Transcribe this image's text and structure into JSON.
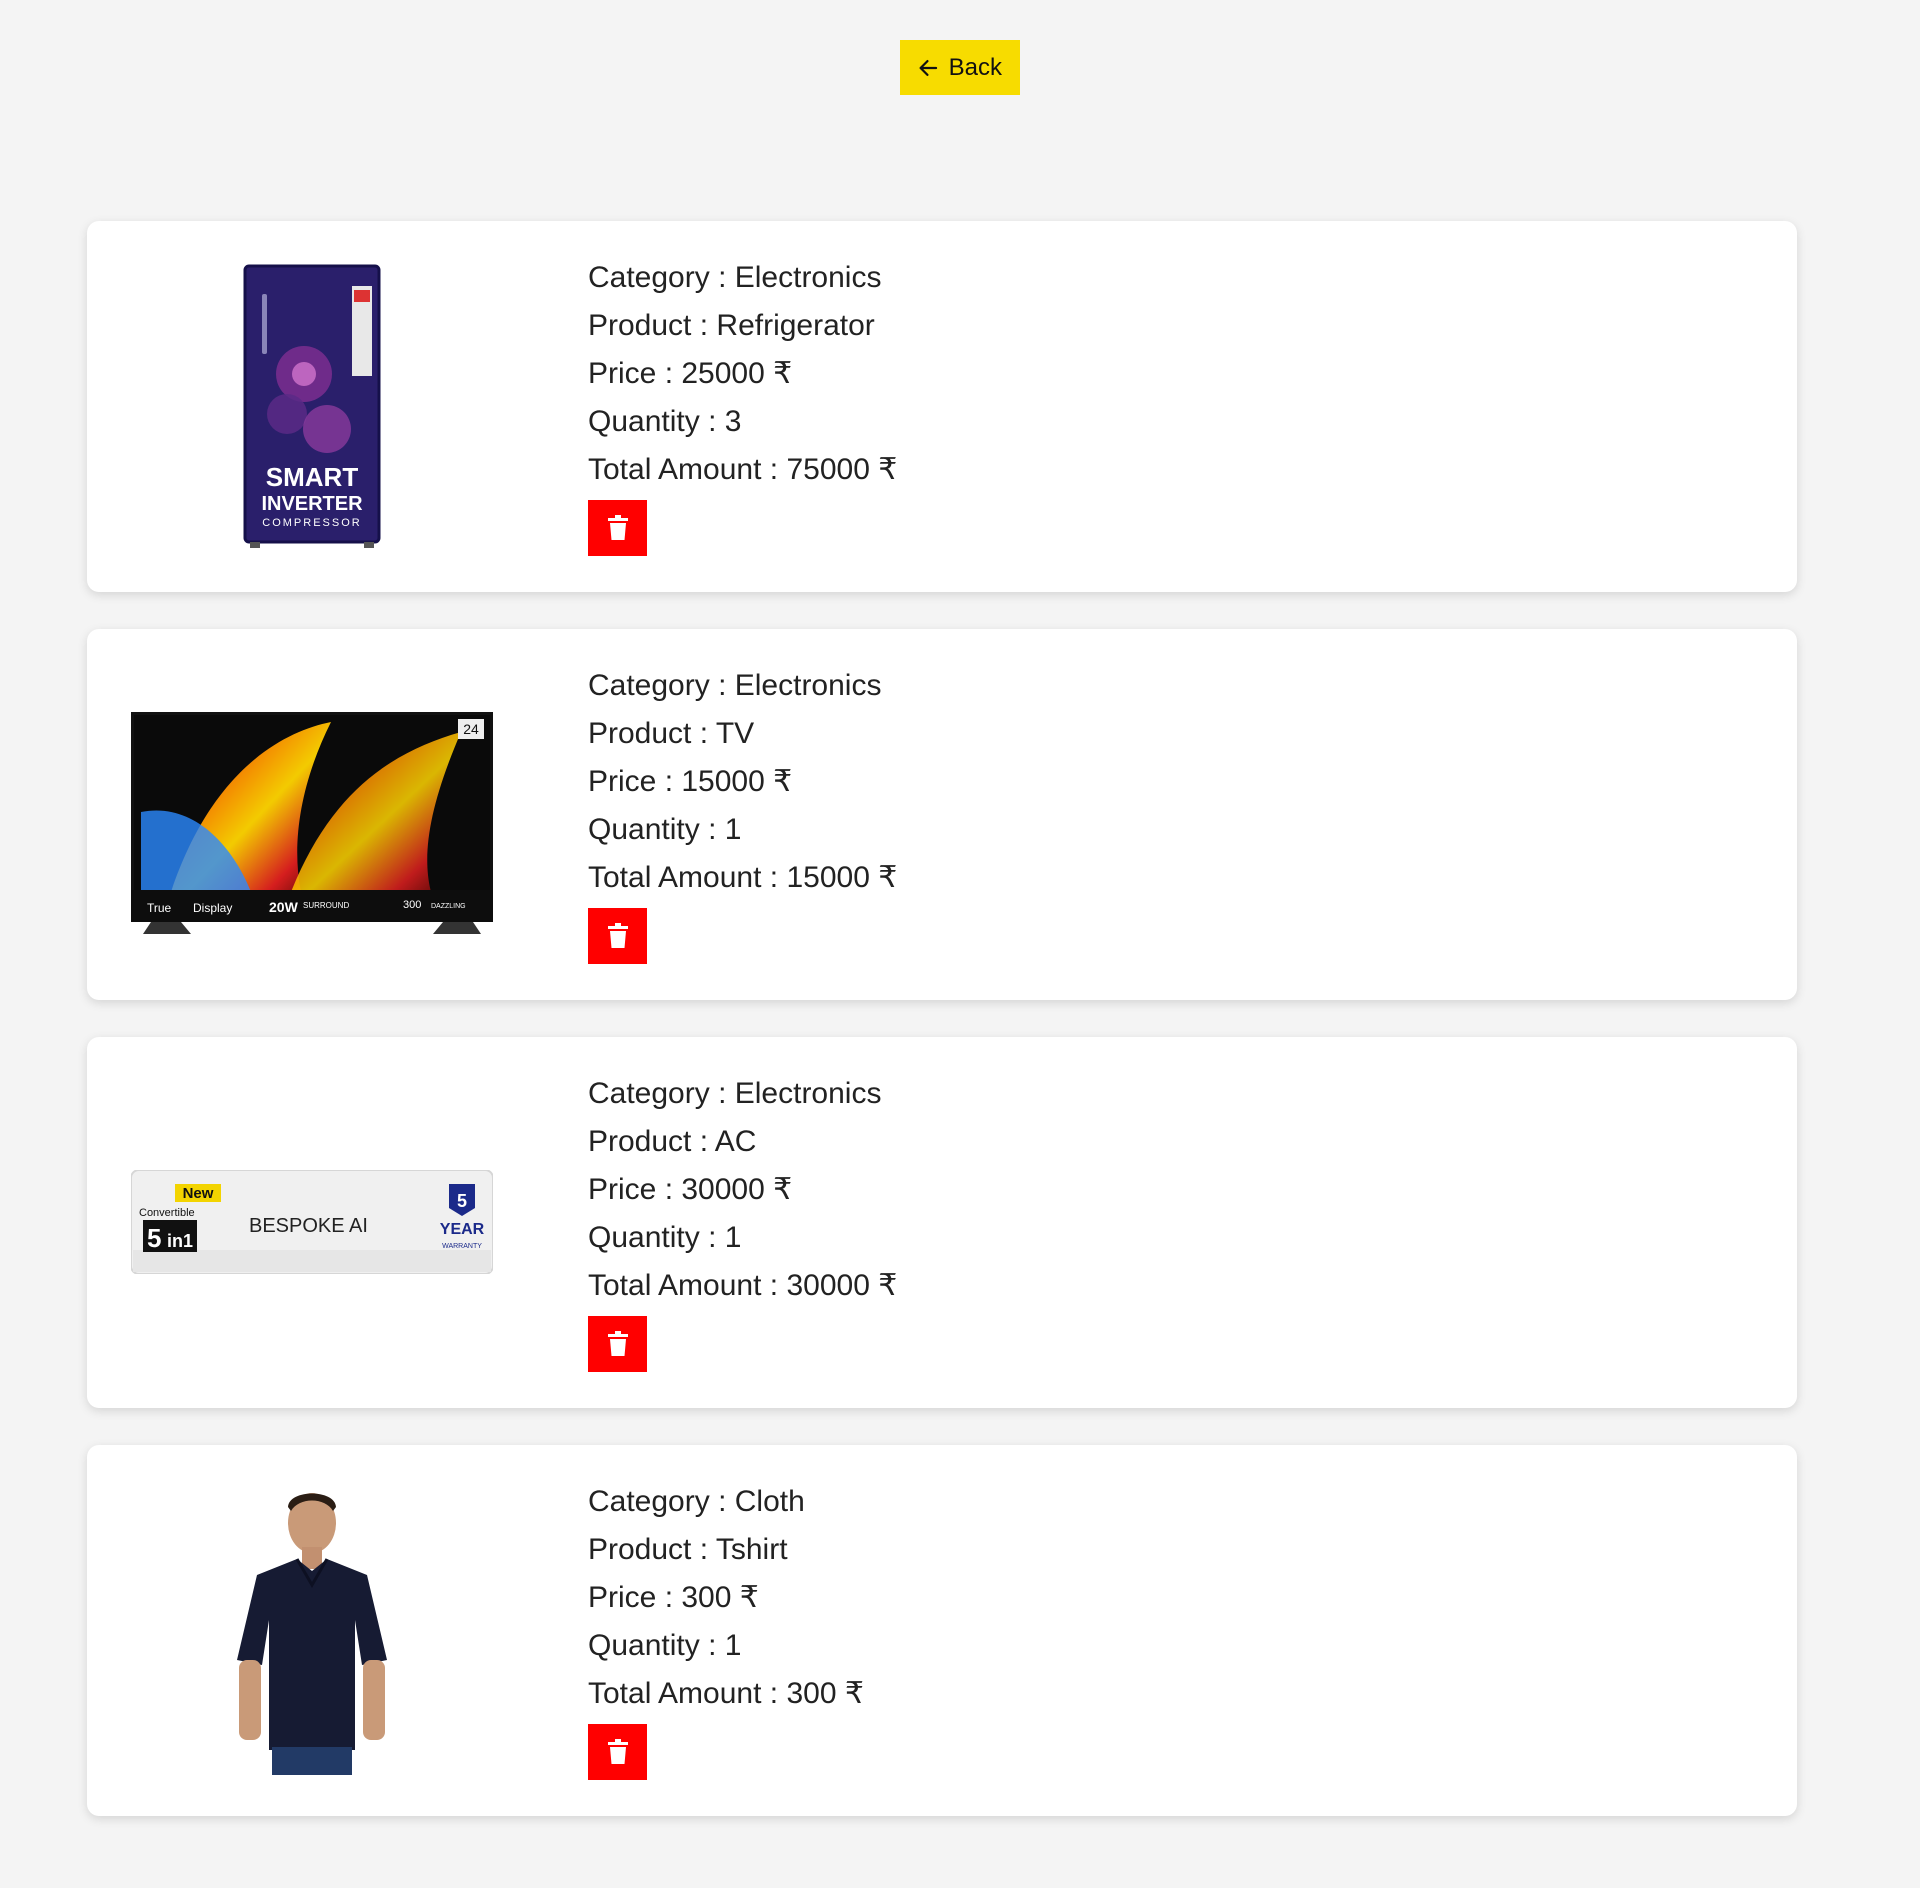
{
  "header": {
    "back_label": "Back"
  },
  "labels": {
    "category": "Category",
    "product": "Product",
    "price": "Price",
    "quantity": "Quantity",
    "total": "Total Amount",
    "separator": " : ",
    "currency": " ₹"
  },
  "cart": [
    {
      "category": "Electronics",
      "product": "Refrigerator",
      "price": "25000",
      "quantity": "3",
      "total": "75000",
      "image_text": {
        "l1": "SMART",
        "l2": "INVERTER",
        "l3": "COMPRESSOR"
      }
    },
    {
      "category": "Electronics",
      "product": "TV",
      "price": "15000",
      "quantity": "1",
      "total": "15000",
      "image_text": {
        "badge": "24",
        "f1": "True",
        "f2": "Display",
        "f3": "20W",
        "f4": "SURROUND",
        "f5": "300",
        "f6": "DAZZLING"
      }
    },
    {
      "category": "Electronics",
      "product": "AC",
      "price": "30000",
      "quantity": "1",
      "total": "30000",
      "image_text": {
        "new": "New",
        "conv": "Convertible",
        "big": "5",
        "in": "in1",
        "brand": "BESPOKE AI",
        "warranty_num": "5",
        "year": "YEAR",
        "warranty": "WARRANTY"
      }
    },
    {
      "category": "Cloth",
      "product": "Tshirt",
      "price": "300",
      "quantity": "1",
      "total": "300",
      "image_text": {}
    }
  ],
  "colors": {
    "accent_yellow": "#f7dc00",
    "danger_red": "#ff0000",
    "background": "#f4f4f4"
  },
  "icons": {
    "back": "arrow-left-icon",
    "delete": "trash-icon"
  }
}
